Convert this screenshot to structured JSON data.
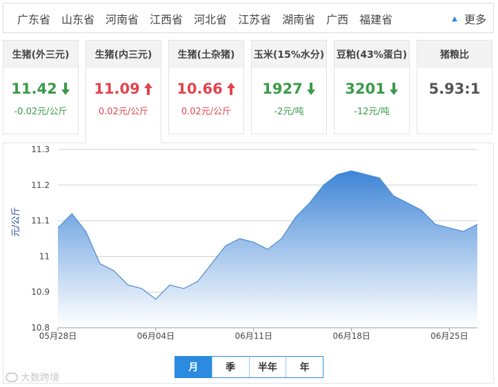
{
  "provinces": [
    "广东省",
    "山东省",
    "河南省",
    "江西省",
    "河北省",
    "江苏省",
    "湖南省",
    "广西",
    "福建省"
  ],
  "more_label": "更多",
  "cards": [
    {
      "title": "生猪(外三元)",
      "value": "11.42",
      "change": "-0.02元/公斤",
      "trend": "down"
    },
    {
      "title": "生猪(内三元)",
      "value": "11.09",
      "change": "0.02元/公斤",
      "trend": "up",
      "active": true
    },
    {
      "title": "生猪(土杂猪)",
      "value": "10.66",
      "change": "0.02元/公斤",
      "trend": "up"
    },
    {
      "title": "玉米(15%水分)",
      "value": "1927",
      "change": "-2元/吨",
      "trend": "down"
    },
    {
      "title": "豆粕(43%蛋白)",
      "value": "3201",
      "change": "-12元/吨",
      "trend": "down"
    },
    {
      "title": "猪粮比",
      "value": "5.93:1",
      "change": "",
      "trend": "none"
    }
  ],
  "colors": {
    "up": "#e2444e",
    "down": "#3a9a4a",
    "accent": "#2a8be0",
    "area_top": "#3d84d6",
    "area_bottom": "#ffffff",
    "line": "#4a8ad4"
  },
  "chart_data": {
    "type": "area",
    "title": "",
    "xlabel": "",
    "ylabel": "元/公斤",
    "ylim": [
      10.8,
      11.3
    ],
    "yticks": [
      10.8,
      10.9,
      11,
      11.1,
      11.2,
      11.3
    ],
    "xtick_labels": [
      "05月28日",
      "06月04日",
      "06月11日",
      "06月18日",
      "06月25日"
    ],
    "xtick_index": [
      0,
      7,
      14,
      21,
      28
    ],
    "grid": true,
    "series": [
      {
        "values": [
          11.08,
          11.12,
          11.07,
          10.98,
          10.96,
          10.92,
          10.91,
          10.88,
          10.92,
          10.91,
          10.93,
          10.98,
          11.03,
          11.05,
          11.04,
          11.02,
          11.05,
          11.11,
          11.15,
          11.2,
          11.23,
          11.24,
          11.23,
          11.22,
          11.17,
          11.15,
          11.13,
          11.09,
          11.08,
          11.07,
          11.09
        ]
      }
    ]
  },
  "range_tabs": [
    {
      "label": "月",
      "active": true
    },
    {
      "label": "季",
      "active": false
    },
    {
      "label": "半年",
      "active": false
    },
    {
      "label": "年",
      "active": false
    }
  ],
  "watermark": "大数跨境"
}
